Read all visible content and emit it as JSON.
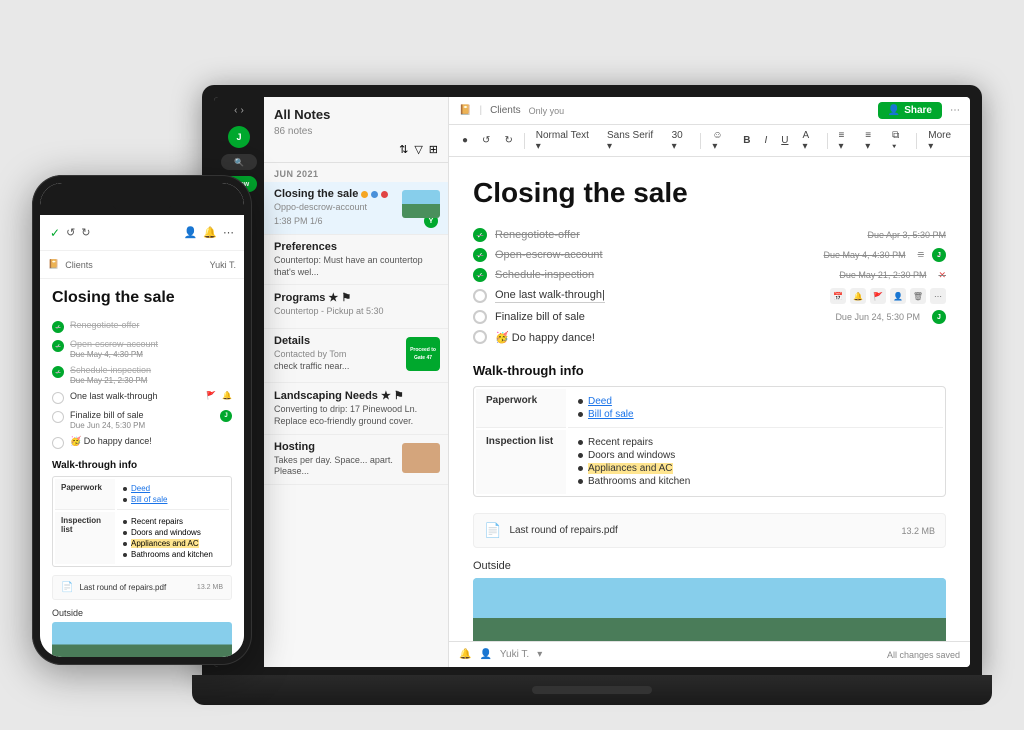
{
  "laptop": {
    "dark_sidebar": {
      "nav_back": "‹",
      "nav_forward": "›",
      "user_initials": "J",
      "search_placeholder": "Search",
      "new_btn_label": "+ New"
    },
    "sidebar": {
      "title": "All Notes",
      "count": "86 notes",
      "section_label": "JUN 2021",
      "notes": [
        {
          "title": "Closing the sale",
          "tags": [
            "yellow",
            "blue",
            "red"
          ],
          "sub": "Oppo-descrow-account",
          "time": "1:38 PM   1/6",
          "avatar": "Y",
          "has_thumb": true,
          "active": true
        },
        {
          "title": "Preferences",
          "tags": [],
          "sub": "",
          "preview": "Countertop: Must have an countertop that's wel...",
          "time": "",
          "avatar": "",
          "has_thumb": false
        },
        {
          "title": "Programs ★ ⚑",
          "tags": [],
          "sub": "Countertop - Pickup at 5:30",
          "preview": "",
          "time": "",
          "avatar": "",
          "has_thumb": false,
          "has_qr": false
        },
        {
          "title": "Details",
          "tags": [],
          "sub": "Contacted by Tom",
          "preview": "check traffic near...",
          "time": "",
          "avatar": "",
          "has_qr": true
        },
        {
          "title": "Landscaping Needs ★ ⚑",
          "tags": [],
          "sub": "Converting to drip: 17 Pinewood Ln. Replace eco-friendly ground cover.",
          "time": "",
          "avatar": "",
          "has_dog": false
        },
        {
          "title": "Hosting",
          "tags": [],
          "sub": "Takes per day. Space... apart. Please...",
          "time": "",
          "avatar": "",
          "has_dog": true
        }
      ]
    },
    "topbar": {
      "notebook_icon": "📔",
      "notebook_label": "Clients",
      "only_you": "Only you",
      "share_label": "Share",
      "more_icon": "⋯"
    },
    "toolbar": {
      "items": [
        "●",
        "↺",
        "↻",
        "Normal Text ▾",
        "Sans Serif ▾",
        "30 ▾",
        "☺ ▾",
        "B",
        "I",
        "U",
        "A ▾",
        "≡ ▾",
        "≡ ▾",
        "⧉ ▾",
        "More ▾"
      ]
    },
    "editor": {
      "title": "Closing the sale",
      "tasks": [
        {
          "text": "Renegotiote-offer",
          "done": true,
          "due": "Due Apr 3, 5:30 PM",
          "has_avatar": false
        },
        {
          "text": "Open-escrow-account",
          "done": true,
          "due": "Due May 4, 4:30 PM",
          "has_avatar": true,
          "avatar": "J"
        },
        {
          "text": "Schedule-inspection",
          "done": true,
          "due": "Due May 21, 2:30 PM",
          "has_avatar": false
        },
        {
          "text": "One last walk-through|",
          "done": false,
          "due": "",
          "has_input_icons": true
        },
        {
          "text": "Finalize bill of sale",
          "done": false,
          "due": "Due Jun 24, 5:30 PM",
          "has_avatar": true,
          "avatar_green": true
        },
        {
          "text": "🥳 Do happy dance!",
          "done": false,
          "due": "",
          "has_avatar": false
        }
      ],
      "walk_through_section": "Walk-through info",
      "table": {
        "rows": [
          {
            "label": "Paperwork",
            "items": [
              "Deed",
              "Bill of sale"
            ],
            "links": [
              true,
              true
            ]
          },
          {
            "label": "Inspection list",
            "items": [
              "Recent repairs",
              "Doors and windows",
              "Appliances and AC",
              "Bathrooms and kitchen"
            ],
            "highlight": [
              false,
              false,
              true,
              false
            ]
          }
        ]
      },
      "attachment": {
        "name": "Last round of repairs.pdf",
        "size": "13.2 MB"
      },
      "outside_label": "Outside"
    },
    "bottombar": {
      "bell_icon": "🔔",
      "user_label": "Yuki T.",
      "changes_saved": "All changes saved"
    }
  },
  "phone": {
    "header": {
      "check_icon": "✓",
      "undo_icon": "↺",
      "redo_icon": "↻",
      "person_icon": "👤",
      "bell_icon": "🔔",
      "more_icon": "⋯"
    },
    "topbar": {
      "notebook_label": "Clients",
      "user_label": "Yuki T."
    },
    "editor": {
      "title": "Closing the sale",
      "tasks": [
        {
          "text": "Renegotiote-offer",
          "done": true,
          "due": ""
        },
        {
          "text": "Open-escrow-account",
          "done": true,
          "due": "Due May 4, 4:30 PM"
        },
        {
          "text": "Schedule-inspection",
          "done": true,
          "due": "Due May 21, 2:30 PM"
        },
        {
          "text": "One last walk-through",
          "done": false,
          "due": "",
          "icons": true
        },
        {
          "text": "Finalize bill of sale",
          "done": false,
          "due": "Due Jun 24, 5:30 PM"
        },
        {
          "text": "🥳 Do happy dance!",
          "done": false,
          "due": ""
        }
      ],
      "section": "Walk-through info",
      "table": {
        "rows": [
          {
            "label": "Paperwork",
            "items": [
              "Deed",
              "Bill of sale"
            ],
            "links": [
              true,
              true
            ],
            "highlight": [
              false,
              false
            ]
          },
          {
            "label": "Inspection list",
            "items": [
              "Recent repairs",
              "Doors and windows",
              "Appliances and AC",
              "Bathrooms and kitchen"
            ],
            "links": [
              false,
              false,
              false,
              false
            ],
            "highlight": [
              false,
              false,
              true,
              false
            ]
          }
        ]
      },
      "attachment": {
        "name": "Last round of repairs.pdf",
        "size": "13.2 MB"
      },
      "outside_label": "Outside"
    }
  }
}
